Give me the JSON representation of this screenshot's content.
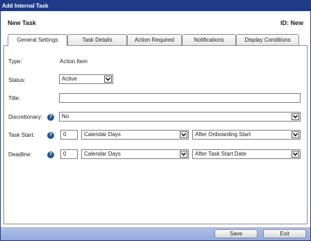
{
  "window": {
    "title": "Add Internal Task"
  },
  "header": {
    "title": "New Task",
    "id_text": "ID: New"
  },
  "tabs": [
    {
      "label": "General Settings",
      "active": true
    },
    {
      "label": "Task Details",
      "active": false
    },
    {
      "label": "Action Required",
      "active": false
    },
    {
      "label": "Notifications",
      "active": false
    },
    {
      "label": "Display Conditions",
      "active": false
    }
  ],
  "form": {
    "type": {
      "label": "Type:",
      "value": "Action Item"
    },
    "status": {
      "label": "Status:",
      "value": "Active"
    },
    "title": {
      "label": "Title:",
      "value": ""
    },
    "discretionary": {
      "label": "Discretionary:",
      "value": "No"
    },
    "task_start": {
      "label": "Task Start:",
      "number": "0",
      "unit": "Calendar Days",
      "relative": "After Onboarding Start"
    },
    "deadline": {
      "label": "Deadline:",
      "number": "0",
      "unit": "Calendar Days",
      "relative": "After Task Start Date"
    }
  },
  "footer": {
    "save_label": "Save",
    "exit_label": "Exit"
  },
  "colors": {
    "title_bar": "#1f3a86",
    "footer": "#9fb3e0",
    "help_icon": "#1e5799"
  }
}
